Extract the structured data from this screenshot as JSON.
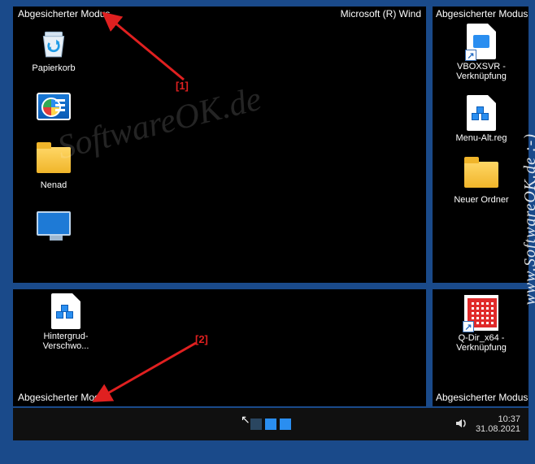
{
  "safe_mode_label": "Abgesicherter Modus",
  "build_label": "Microsoft (R) Wind",
  "watermark_text": "SoftwareOK.de",
  "side_watermark_text": "www.SoftwareOK.de :-)",
  "markers": {
    "m1": "[1]",
    "m2": "[2]"
  },
  "main_panel": {
    "icons": [
      {
        "name": "recycle-bin",
        "label": "Papierkorb"
      },
      {
        "name": "control-panel",
        "label": ""
      },
      {
        "name": "folder-nenad",
        "label": "Nenad"
      },
      {
        "name": "this-pc",
        "label": ""
      }
    ]
  },
  "right_panel": {
    "icons": [
      {
        "name": "vboxsvr-shortcut",
        "label": "VBOXSVR - Verknüpfung"
      },
      {
        "name": "menu-alt-reg",
        "label": "Menu-Alt.reg"
      },
      {
        "name": "neuer-ordner",
        "label": "Neuer Ordner"
      }
    ]
  },
  "bottom_left_panel": {
    "icons": [
      {
        "name": "hintergrund-reg",
        "label": "Hintergrud-Verschwo..."
      }
    ]
  },
  "bottom_right_panel": {
    "icons": [
      {
        "name": "qdir-shortcut",
        "label": "Q-Dir_x64 - Verknüpfung"
      }
    ]
  },
  "taskbar": {
    "time": "10:37",
    "date": "31.08.2021"
  }
}
